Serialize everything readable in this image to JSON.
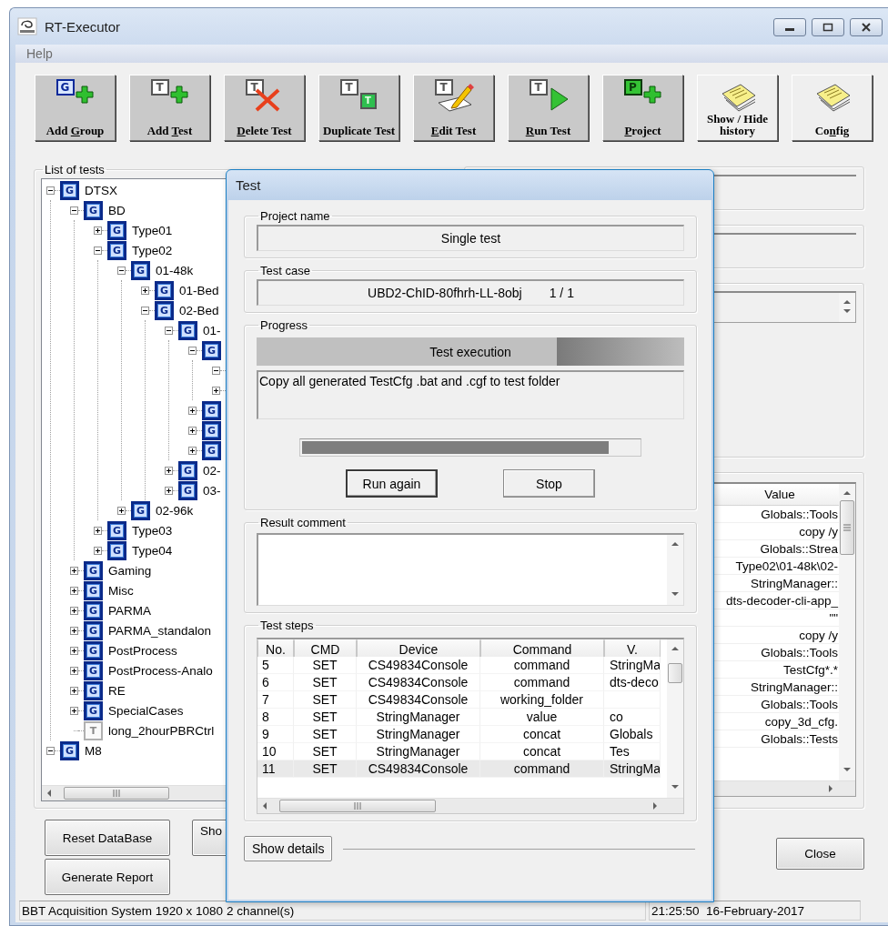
{
  "window": {
    "title": "RT-Executor"
  },
  "menu": [
    "Help"
  ],
  "toolbar": [
    {
      "label": "Add Group",
      "badge": "G"
    },
    {
      "label": "Add Test",
      "badge": "T"
    },
    {
      "label": "Delete Test",
      "badge": "T"
    },
    {
      "label": "Duplicate Test",
      "badge": "T",
      "badge2": "T"
    },
    {
      "label": "Edit Test",
      "badge": "T"
    },
    {
      "label": "Run Test",
      "badge": "T"
    },
    {
      "label": "Project",
      "badge": "P"
    },
    {
      "label": "Show / Hide history"
    },
    {
      "label": "Config"
    }
  ],
  "tree": {
    "label": "List of tests",
    "nodes": [
      {
        "label": "DTSX",
        "badge": "G",
        "kind": "group",
        "expanded": true,
        "children": [
          {
            "label": "BD",
            "badge": "G",
            "kind": "group",
            "expanded": true,
            "children": [
              {
                "label": "Type01",
                "badge": "G",
                "kind": "group",
                "expanded": false
              },
              {
                "label": "Type02",
                "badge": "G",
                "kind": "group",
                "expanded": true,
                "children": [
                  {
                    "label": "01-48k",
                    "badge": "G",
                    "kind": "group",
                    "expanded": true,
                    "children": [
                      {
                        "label": "01-Bed",
                        "badge": "G",
                        "kind": "group",
                        "expanded": false
                      },
                      {
                        "label": "02-Bed",
                        "badge": "G",
                        "kind": "group",
                        "expanded": true,
                        "children": [
                          {
                            "label": "01-",
                            "badge": "G",
                            "kind": "group",
                            "expanded": true,
                            "children": [
                              {
                                "badge": "G",
                                "kind": "group",
                                "expanded": true,
                                "children": [
                                  {
                                    "kind": "group",
                                    "expanded": true
                                  },
                                  {
                                    "kind": "group",
                                    "expanded": false
                                  }
                                ]
                              },
                              {
                                "badge": "G",
                                "kind": "group",
                                "expanded": false
                              },
                              {
                                "badge": "G",
                                "kind": "group",
                                "expanded": false
                              },
                              {
                                "badge": "G",
                                "kind": "group",
                                "expanded": false
                              }
                            ]
                          },
                          {
                            "label": "02-",
                            "badge": "G",
                            "kind": "group",
                            "expanded": false
                          },
                          {
                            "label": "03-",
                            "badge": "G",
                            "kind": "group",
                            "expanded": false
                          }
                        ]
                      }
                    ]
                  },
                  {
                    "label": "02-96k",
                    "badge": "G",
                    "kind": "group",
                    "expanded": false
                  }
                ]
              },
              {
                "label": "Type03",
                "badge": "G",
                "kind": "group",
                "expanded": false
              },
              {
                "label": "Type04",
                "badge": "G",
                "kind": "group",
                "expanded": false
              }
            ]
          },
          {
            "label": "Gaming",
            "badge": "G",
            "kind": "group",
            "expanded": false
          },
          {
            "label": "Misc",
            "badge": "G",
            "kind": "group",
            "expanded": false
          },
          {
            "label": "PARMA",
            "badge": "G",
            "kind": "group",
            "expanded": false
          },
          {
            "label": "PARMA_standalon",
            "badge": "G",
            "kind": "group",
            "expanded": false
          },
          {
            "label": "PostProcess",
            "badge": "G",
            "kind": "group",
            "expanded": false
          },
          {
            "label": "PostProcess-Analo",
            "badge": "G",
            "kind": "group",
            "expanded": false
          },
          {
            "label": "RE",
            "badge": "G",
            "kind": "group",
            "expanded": false
          },
          {
            "label": "SpecialCases",
            "badge": "G",
            "kind": "group",
            "expanded": false
          },
          {
            "label": "long_2hourPBRCtrl",
            "badge": "T",
            "kind": "test"
          }
        ]
      },
      {
        "label": "M8",
        "badge": "G",
        "kind": "group",
        "expanded": true
      }
    ]
  },
  "history": {
    "columns": [
      "Value"
    ],
    "rows": [
      "Globals::Tools",
      "copy /y",
      "Globals::Strea",
      "Type02\\01-48k\\02-",
      "StringManager::",
      "dts-decoder-cli-app_",
      "\"\"",
      "copy /y",
      "Globals::Tools",
      "TestCfg*.*",
      "StringManager::",
      "Globals::Tools",
      "copy_3d_cfg.",
      "Globals::Tests"
    ]
  },
  "bottom_buttons": [
    "Reset DataBase",
    "Generate Report"
  ],
  "show_button": "Sho",
  "close_button": "Close",
  "status_bar": {
    "message": "BBT Acquisition System 1920 x 1080 2 channel(s)",
    "datetime": "21:25:50  16-February-2017"
  },
  "dialog": {
    "title": "Test",
    "project_name": {
      "label": "Project name",
      "value": "Single test"
    },
    "test_case": {
      "label": "Test case",
      "value": "UBD2-ChID-80fhrh-LL-8obj",
      "counter": "1 / 1"
    },
    "progress": {
      "label": "Progress",
      "stage": "Test execution",
      "message": "Copy all generated TestCfg .bat and .cgf to test folder",
      "level": 0.91
    },
    "buttons": [
      {
        "label": "Run again",
        "default": true
      },
      {
        "label": "Stop",
        "default": false
      }
    ],
    "result_comment": {
      "label": "Result comment"
    },
    "test_steps": {
      "label": "Test steps",
      "columns": [
        "No.",
        "CMD",
        "Device",
        "Command",
        "V."
      ],
      "rows": [
        {
          "cells": [
            "5",
            "SET",
            "CS49834Console",
            "command",
            "StringMa"
          ],
          "selected": false
        },
        {
          "cells": [
            "6",
            "SET",
            "CS49834Console",
            "command",
            "dts-deco"
          ],
          "selected": false
        },
        {
          "cells": [
            "7",
            "SET",
            "CS49834Console",
            "working_folder",
            ""
          ],
          "selected": false
        },
        {
          "cells": [
            "8",
            "SET",
            "StringManager",
            "value",
            "co"
          ],
          "selected": false
        },
        {
          "cells": [
            "9",
            "SET",
            "StringManager",
            "concat",
            "Globals"
          ],
          "selected": false
        },
        {
          "cells": [
            "10",
            "SET",
            "StringManager",
            "concat",
            "Tes"
          ],
          "selected": false
        },
        {
          "cells": [
            "11",
            "SET",
            "CS49834Console",
            "command",
            "StringMa"
          ],
          "selected": true
        }
      ]
    },
    "show_details": "Show details"
  }
}
